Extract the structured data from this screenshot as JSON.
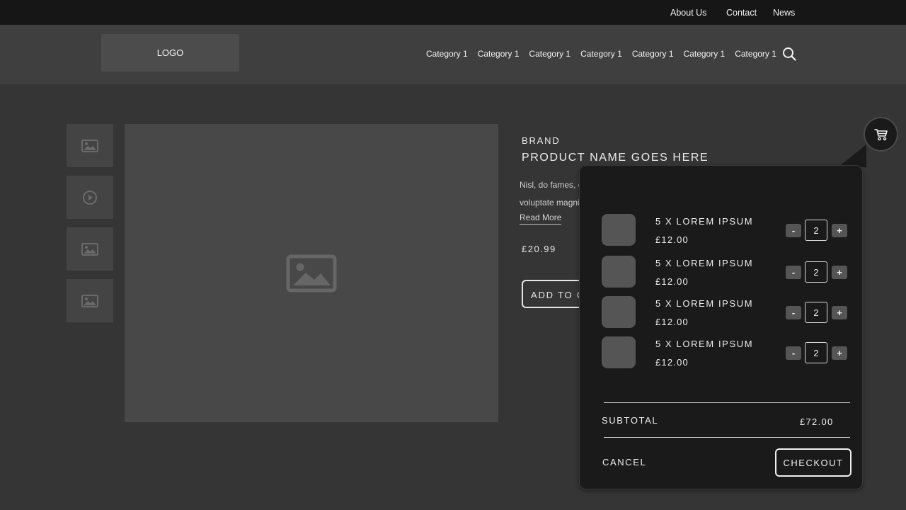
{
  "topbar": {
    "links": [
      "About Us",
      "Contact",
      "News"
    ]
  },
  "header": {
    "logo": "LOGO",
    "nav": [
      "Category 1",
      "Category 1",
      "Category 1",
      "Category 1",
      "Category 1",
      "Category 1",
      "Category 1"
    ],
    "search_icon": "search-icon"
  },
  "gallery": {
    "thumbnails": [
      "image-icon",
      "play-icon",
      "image-icon",
      "image-icon"
    ],
    "main_icon": "image-icon"
  },
  "product": {
    "brand": "BRAND",
    "name": "PRODUCT NAME GOES HERE",
    "description_lines": [
      "Nisl, do fames, c",
      "voluptate magni"
    ],
    "read_more": "Read More",
    "price": "£20.99",
    "add_to_cart": "ADD TO C"
  },
  "cart": {
    "icon": "cart-icon",
    "items": [
      {
        "name": "5 X LOREM IPSUM",
        "price": "£12.00",
        "qty": "2"
      },
      {
        "name": "5 X LOREM IPSUM",
        "price": "£12.00",
        "qty": "2"
      },
      {
        "name": "5 X LOREM IPSUM",
        "price": "£12.00",
        "qty": "2"
      },
      {
        "name": "5 X LOREM IPSUM",
        "price": "£12.00",
        "qty": "2"
      }
    ],
    "minus": "-",
    "plus": "+",
    "subtotal_label": "SUBTOTAL",
    "subtotal_value": "£72.00",
    "cancel": "CANCEL",
    "checkout": "CHECKOUT"
  },
  "colors": {
    "page_bg": "#353535",
    "topbar_bg": "#161616",
    "header_bg": "#3f3f3f",
    "panel_bg": "#1a1a1a"
  }
}
